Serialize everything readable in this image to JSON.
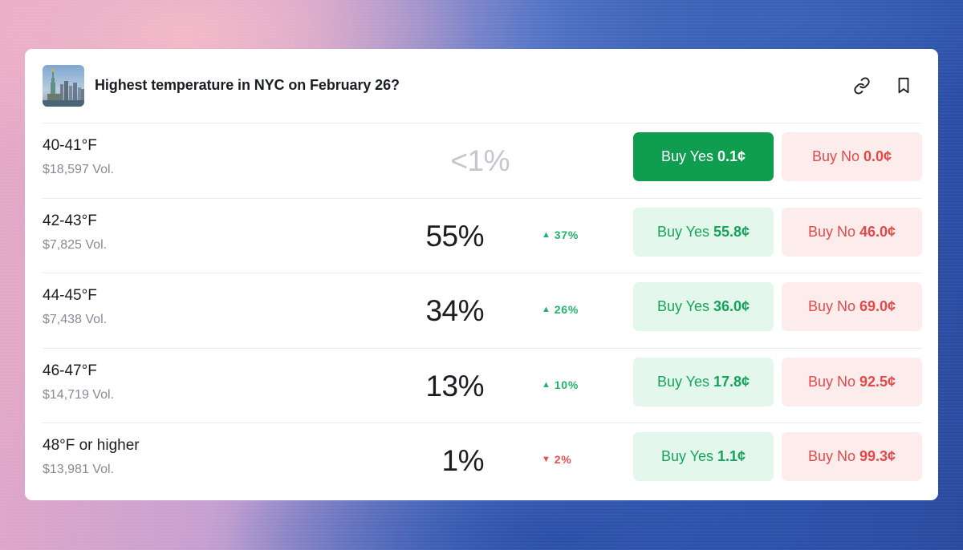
{
  "market": {
    "title": "Highest temperature in NYC on February 26?",
    "thumbnail_icon": "statue-of-liberty-thumbnail"
  },
  "header_actions": {
    "link_icon": "link-icon",
    "bookmark_icon": "bookmark-icon"
  },
  "colors": {
    "yes_accent": "#16a35a",
    "yes_solid": "#0f9d4f",
    "yes_bg": "#e4f7ec",
    "no_accent": "#e24a4a",
    "no_bg": "#fdecec",
    "up": "#20b36a",
    "down": "#e64e4e"
  },
  "outcomes": [
    {
      "range": "40-41°F",
      "volume": "$18,597 Vol.",
      "probability": "<1%",
      "change": "",
      "direction": "none",
      "yes_label": "Buy Yes",
      "yes_price": "0.1¢",
      "no_label": "Buy No",
      "no_price": "0.0¢"
    },
    {
      "range": "42-43°F",
      "volume": "$7,825 Vol.",
      "probability": "55%",
      "change": "37%",
      "direction": "up",
      "yes_label": "Buy Yes",
      "yes_price": "55.8¢",
      "no_label": "Buy No",
      "no_price": "46.0¢"
    },
    {
      "range": "44-45°F",
      "volume": "$7,438 Vol.",
      "probability": "34%",
      "change": "26%",
      "direction": "up",
      "yes_label": "Buy Yes",
      "yes_price": "36.0¢",
      "no_label": "Buy No",
      "no_price": "69.0¢"
    },
    {
      "range": "46-47°F",
      "volume": "$14,719 Vol.",
      "probability": "13%",
      "change": "10%",
      "direction": "up",
      "yes_label": "Buy Yes",
      "yes_price": "17.8¢",
      "no_label": "Buy No",
      "no_price": "92.5¢"
    },
    {
      "range": "48°F or higher",
      "volume": "$13,981 Vol.",
      "probability": "1%",
      "change": "2%",
      "direction": "down",
      "yes_label": "Buy Yes",
      "yes_price": "1.1¢",
      "no_label": "Buy No",
      "no_price": "99.3¢"
    }
  ]
}
